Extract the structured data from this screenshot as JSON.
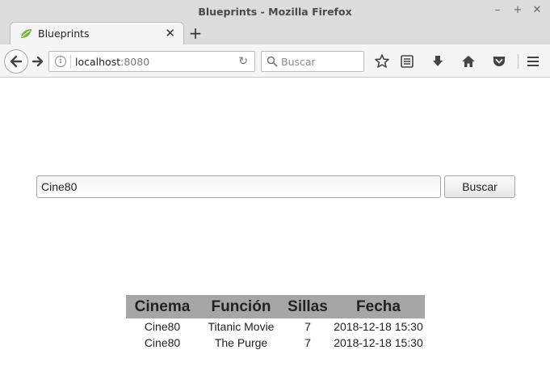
{
  "window": {
    "title": "Blueprints - Mozilla Firefox"
  },
  "tab": {
    "label": "Blueprints"
  },
  "urlbar": {
    "host": "localhost",
    "port": ":8080"
  },
  "searchbar": {
    "placeholder": "Buscar"
  },
  "page": {
    "cinema_input_value": "Cine80",
    "search_button_label": "Buscar",
    "table": {
      "headers": [
        "Cinema",
        "Función",
        "Sillas",
        "Fecha"
      ],
      "rows": [
        [
          "Cine80",
          "Titanic Movie",
          "7",
          "2018-12-18 15:30"
        ],
        [
          "Cine80",
          "The Purge",
          "7",
          "2018-12-18 15:30"
        ]
      ]
    }
  },
  "colors": {
    "table_header_bg": "#a6a6a6",
    "chrome_bg": "#dcdcdc",
    "toolbar_bg": "#f5f5f5"
  },
  "icons": [
    "minimize-icon",
    "maximize-icon",
    "close-window-icon",
    "leaf-favicon-icon",
    "tab-close-icon",
    "new-tab-icon",
    "back-icon",
    "forward-icon",
    "info-icon",
    "reload-icon",
    "search-icon",
    "bookmark-star-icon",
    "reading-list-icon",
    "download-icon",
    "home-icon",
    "pocket-icon",
    "menu-icon"
  ]
}
